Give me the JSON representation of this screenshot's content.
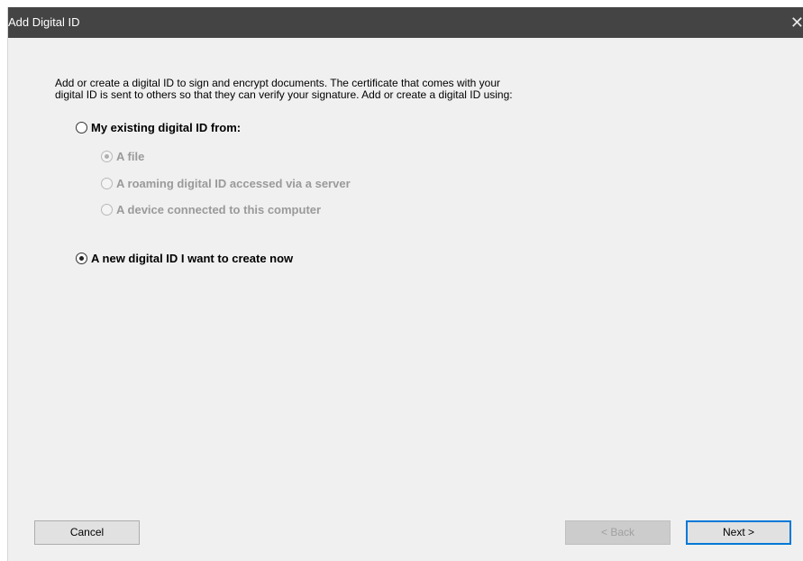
{
  "dialog": {
    "title": "Add Digital ID",
    "close_glyph": "✕"
  },
  "intro": {
    "line1": "Add or create a digital ID to sign and encrypt documents. The certificate that comes with your",
    "line2": "digital ID is sent to others so that they can verify your signature. Add or create a digital ID using:"
  },
  "options": {
    "existing": {
      "label": "My existing digital ID from:",
      "selected": false,
      "enabled": true
    },
    "sub_options": [
      {
        "label": "A file",
        "selected": true,
        "enabled": false
      },
      {
        "label": "A roaming digital ID accessed via a server",
        "selected": false,
        "enabled": false
      },
      {
        "label": "A device connected to this computer",
        "selected": false,
        "enabled": false
      }
    ],
    "new_id": {
      "label": "A new digital ID I want to create now",
      "selected": true,
      "enabled": true
    }
  },
  "buttons": {
    "cancel": "Cancel",
    "back": "< Back",
    "next": "Next >"
  },
  "colors": {
    "titlebar": "#444444",
    "dialog_bg": "#f0f0f0",
    "disabled_text": "#9a9a9a",
    "accent": "#0078d7"
  }
}
